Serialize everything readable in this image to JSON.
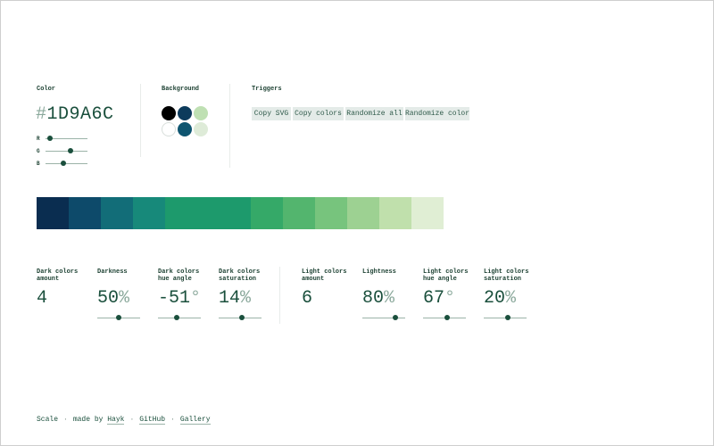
{
  "color": {
    "label": "Color",
    "hash": "#",
    "hex": "1D9A6C",
    "sliders": [
      {
        "letter": "R",
        "value": 0.1
      },
      {
        "letter": "G",
        "value": 0.6
      },
      {
        "letter": "B",
        "value": 0.42
      }
    ]
  },
  "background": {
    "label": "Background",
    "swatches": [
      {
        "color": "#000000",
        "name": "black"
      },
      {
        "color": "#0d3b5c",
        "name": "dark-navy"
      },
      {
        "color": "#bfe0b3",
        "name": "light-green"
      },
      {
        "color": "#ffffff",
        "name": "white"
      },
      {
        "color": "#0e5570",
        "name": "teal"
      },
      {
        "color": "#deebd8",
        "name": "pale-green"
      }
    ]
  },
  "triggers": {
    "label": "Triggers",
    "buttons": [
      "Copy SVG",
      "Copy colors",
      "Randomize all",
      "Randomize color"
    ]
  },
  "scale": {
    "colors": [
      "#0a2d50",
      "#0d4a6a",
      "#126d78",
      "#17897a",
      "#1d9a6c",
      "#1d9a6c",
      "#35a968",
      "#53b56e",
      "#77c47d",
      "#9dd192",
      "#c0e0ac",
      "#e0eed4"
    ]
  },
  "params": [
    {
      "label": "Dark colors amount",
      "value": "4",
      "unit": "",
      "slider": null
    },
    {
      "label": "Darkness",
      "value": "50",
      "unit": "%",
      "slider": 0.5
    },
    {
      "label": "Dark colors hue angle",
      "value": "-51",
      "unit": "°",
      "slider": 0.43
    },
    {
      "label": "Dark colors saturation",
      "value": "14",
      "unit": "%",
      "slider": 0.55
    },
    {
      "label": "Light colors amount",
      "value": "6",
      "unit": "",
      "slider": null
    },
    {
      "label": "Lightness",
      "value": "80",
      "unit": "%",
      "slider": 0.77
    },
    {
      "label": "Light colors hue angle",
      "value": "67",
      "unit": "°",
      "slider": 0.57
    },
    {
      "label": "Light colors saturation",
      "value": "20",
      "unit": "%",
      "slider": 0.57
    }
  ],
  "footer": {
    "app": "Scale",
    "made_by": "made by",
    "author": "Hayk",
    "github": "GitHub",
    "gallery": "Gallery",
    "separator": "·"
  }
}
